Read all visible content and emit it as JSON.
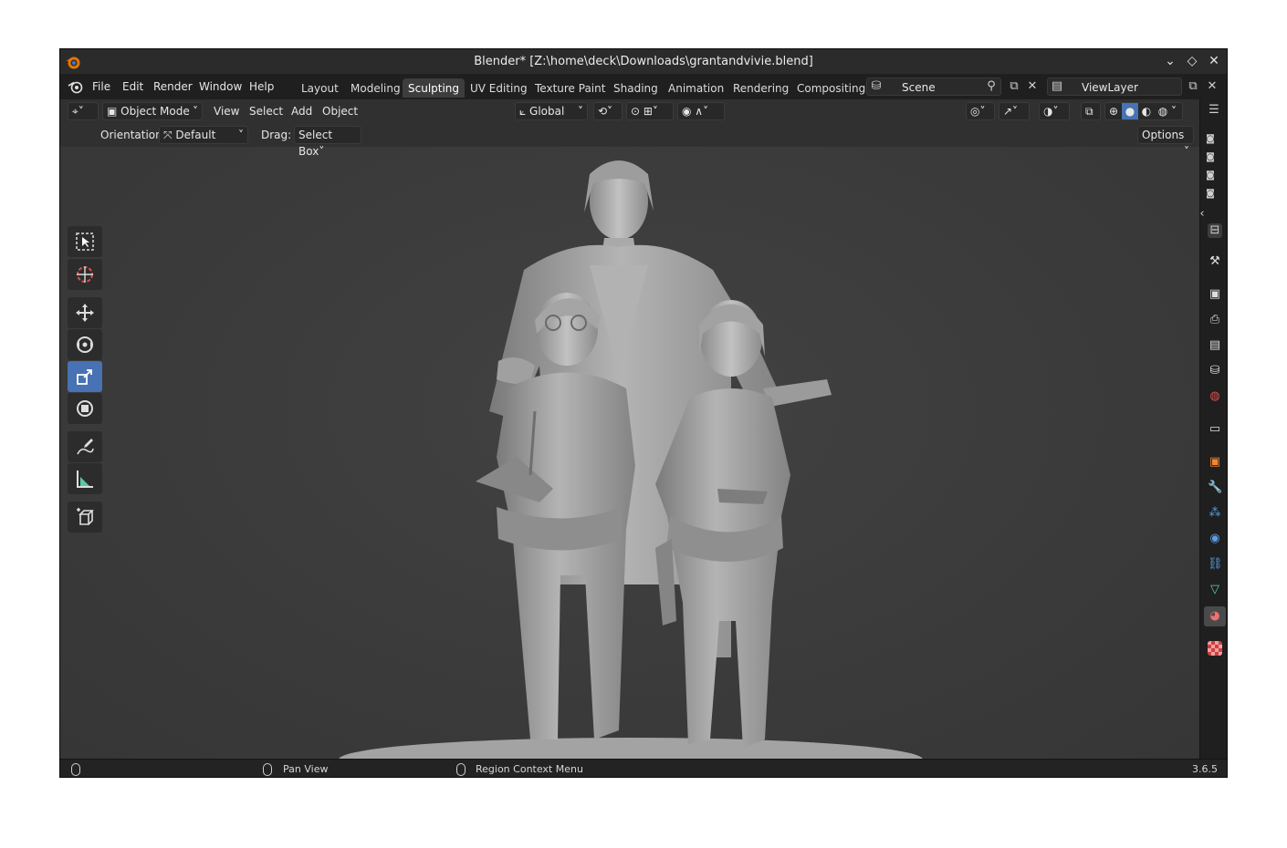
{
  "window": {
    "title": "Blender* [Z:\\home\\deck\\Downloads\\grantandvivie.blend]"
  },
  "menu": {
    "items": [
      "File",
      "Edit",
      "Render",
      "Window",
      "Help"
    ]
  },
  "workspaces": {
    "tabs": [
      "Layout",
      "Modeling",
      "Sculpting",
      "UV Editing",
      "Texture Paint",
      "Shading",
      "Animation",
      "Rendering",
      "Compositing"
    ],
    "active": "Sculpting"
  },
  "scene": {
    "name": "Scene"
  },
  "view_layer": {
    "name": "ViewLayer"
  },
  "viewport_header": {
    "mode": "Object Mode",
    "menus": [
      "View",
      "Select",
      "Add",
      "Object"
    ],
    "transform_orientation": "Global"
  },
  "tool_settings": {
    "orientation_label": "Orientation:",
    "orientation_value": "Default",
    "drag_label": "Drag:",
    "drag_value": "Select Box",
    "options_label": "Options"
  },
  "statusbar": {
    "middle_mouse": "Pan View",
    "right_mouse": "Region Context Menu",
    "version": "3.6.5"
  },
  "colors": {
    "accent_blue": "#4772b3",
    "panel_bg": "#303030",
    "viewport_bg": "#3d3d3d",
    "model_gray": "#9a9a9a"
  },
  "icons": {
    "toolbar": [
      "select-box-icon",
      "cursor-icon",
      "move-icon",
      "rotate-icon",
      "scale-icon",
      "transform-icon",
      "annotate-icon",
      "measure-icon",
      "add-cube-icon"
    ],
    "properties": [
      "tool-icon",
      "render-icon",
      "output-icon",
      "view-layer-icon",
      "scene-icon",
      "world-icon",
      "collection-icon",
      "object-icon",
      "modifier-icon",
      "particles-icon",
      "physics-icon",
      "constraints-icon",
      "data-icon",
      "material-icon",
      "texture-icon"
    ]
  }
}
